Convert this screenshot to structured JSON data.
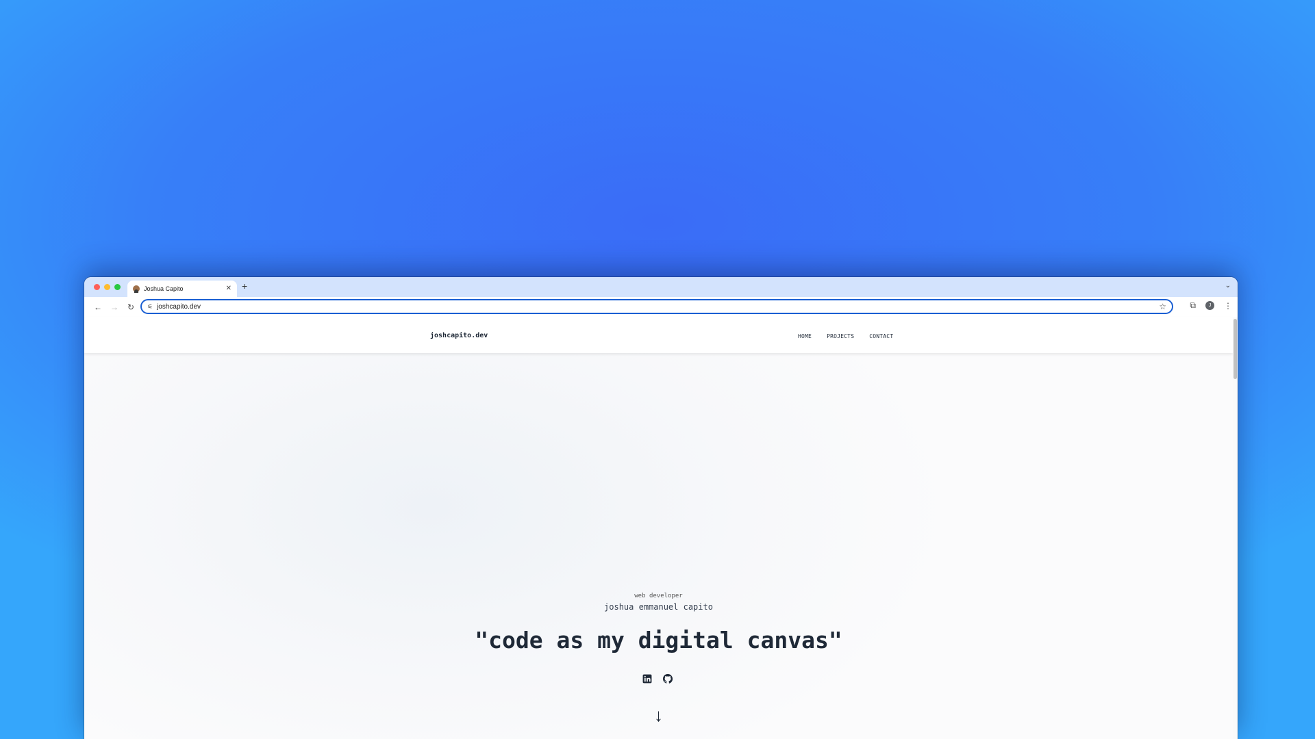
{
  "browser": {
    "tab": {
      "title": "Joshua Capito"
    },
    "address_bar": {
      "url": "joshcapito.dev"
    },
    "profile_initial": "J"
  },
  "site": {
    "logo": "joshcapito.dev",
    "nav": [
      "HOME",
      "PROJECTS",
      "CONTACT"
    ],
    "hero": {
      "role": "web developer",
      "name": "joshua emmanuel capito",
      "tagline": "\"code as my digital canvas\""
    },
    "socials": [
      "linkedin-icon",
      "github-icon"
    ],
    "scroll_indicator": "↓"
  }
}
